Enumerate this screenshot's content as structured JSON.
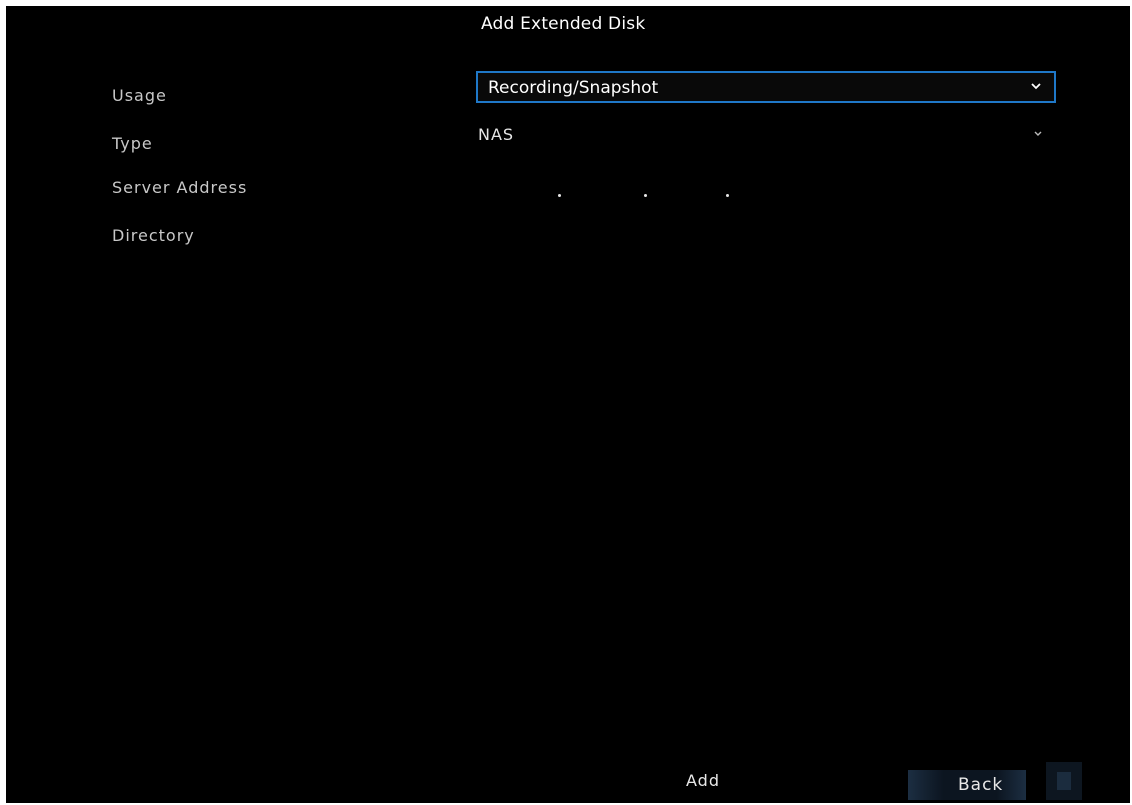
{
  "dialog": {
    "title": "Add Extended Disk"
  },
  "form": {
    "usage": {
      "label": "Usage",
      "value": "Recording/Snapshot",
      "icon": "chevron-down-icon"
    },
    "type": {
      "label": "Type",
      "value": "NAS",
      "icon": "chevron-down-icon"
    },
    "server_address": {
      "label": "Server Address",
      "value": ""
    },
    "directory": {
      "label": "Directory",
      "value": ""
    }
  },
  "buttons": {
    "add": "Add",
    "back": "Back"
  },
  "colors": {
    "background": "#000000",
    "focus_border": "#1f78c8",
    "text": "#ffffff",
    "label_text": "#c8c8c8"
  }
}
